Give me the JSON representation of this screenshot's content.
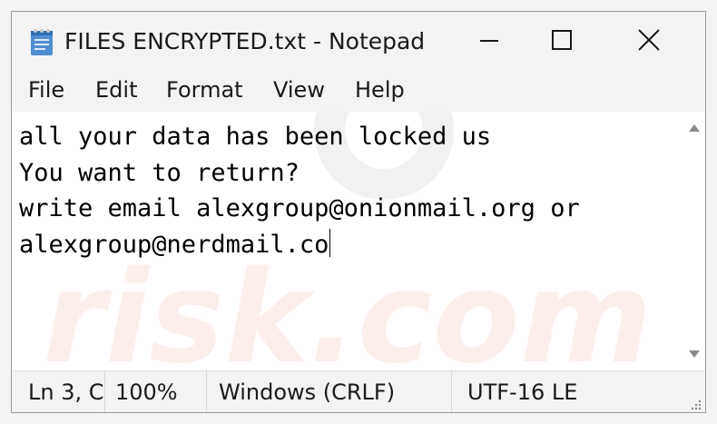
{
  "window": {
    "title": "FILES ENCRYPTED.txt - Notepad"
  },
  "menu": {
    "items": [
      "File",
      "Edit",
      "Format",
      "View",
      "Help"
    ]
  },
  "editor": {
    "lines": [
      "all your data has been locked us",
      "You want to return?",
      "write email alexgroup@onionmail.org or",
      "alexgroup@nerdmail.co"
    ]
  },
  "statusbar": {
    "position": "Ln 3, C",
    "zoom": "100%",
    "line_ending": "Windows (CRLF)",
    "encoding": "UTF-16 LE"
  },
  "watermark": {
    "text": "risk.com"
  },
  "icons": {
    "app": "notepad-icon",
    "minimize": "minimize-icon",
    "maximize": "maximize-icon",
    "close": "close-icon",
    "scroll_up": "chevron-up-icon",
    "scroll_down": "chevron-down-icon",
    "grip": "resize-grip-icon"
  },
  "colors": {
    "chrome": "#f3f3f3",
    "editor_bg": "#ffffff",
    "watermark": "#e8572a"
  }
}
